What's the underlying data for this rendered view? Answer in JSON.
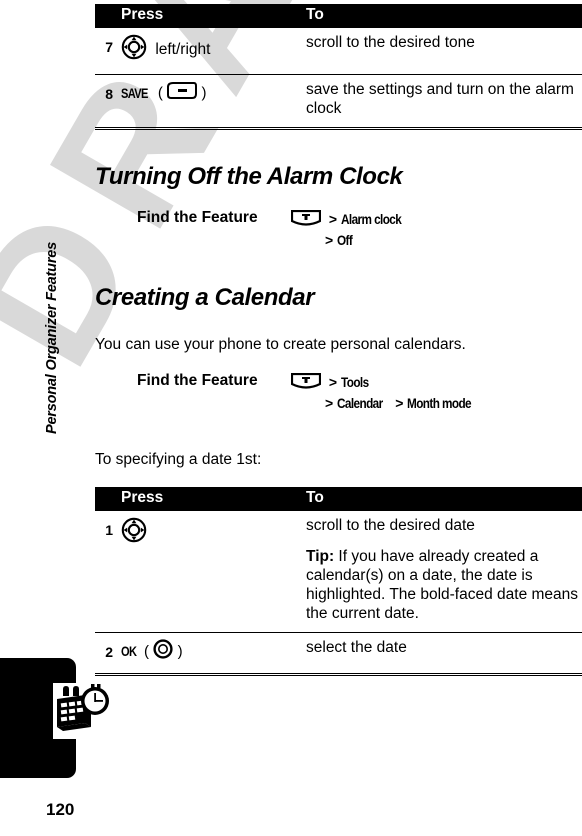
{
  "document": {
    "page_number": "120",
    "watermark_text": "DRAFT",
    "sidebar_label": "Personal Organizer Features",
    "tab_icon": "calendar-clock-icon"
  },
  "table_top": {
    "headers": {
      "press": "Press",
      "to": "To"
    },
    "rows": [
      {
        "number": "7",
        "press_icon": "navigation-key-icon",
        "press_text": "left/right",
        "to_lines": [
          "scroll to the desired tone"
        ]
      },
      {
        "number": "8",
        "press_key_label": "SAVE",
        "press_icon": "soft-key-icon",
        "to_lines": [
          "save the settings and turn on the alarm clock"
        ]
      }
    ]
  },
  "section_alarm": {
    "heading": "Turning Off the Alarm Clock",
    "find_feature": {
      "label": "Find the Feature",
      "menu_icon": "menu-key-icon",
      "path_lines": [
        {
          "prefix": ">",
          "text": "Alarm clock"
        },
        {
          "prefix": ">",
          "text": "Off"
        }
      ]
    }
  },
  "section_calendar": {
    "heading": "Creating a Calendar",
    "intro": "You can use your phone to create personal calendars.",
    "find_feature": {
      "label": "Find the Feature",
      "menu_icon": "menu-key-icon",
      "path_lines": [
        {
          "prefix": ">",
          "text": "Tools"
        },
        {
          "prefix": ">",
          "text": "Calendar",
          "prefix2": ">",
          "text2": "Month mode"
        }
      ]
    },
    "subintro": "To specifying a date 1st:"
  },
  "table_bottom": {
    "headers": {
      "press": "Press",
      "to": "To"
    },
    "rows": [
      {
        "number": "1",
        "press_icon": "navigation-key-icon",
        "to_lines": [
          "scroll to the desired date"
        ],
        "tip_label": "Tip:",
        "tip_text": " If you have already created a calendar(s) on a date, the date is highlighted. The bold-faced date means the current date."
      },
      {
        "number": "2",
        "press_key_label": "OK",
        "press_icon": "ok-key-icon",
        "to_lines": [
          "select the date"
        ]
      }
    ]
  }
}
